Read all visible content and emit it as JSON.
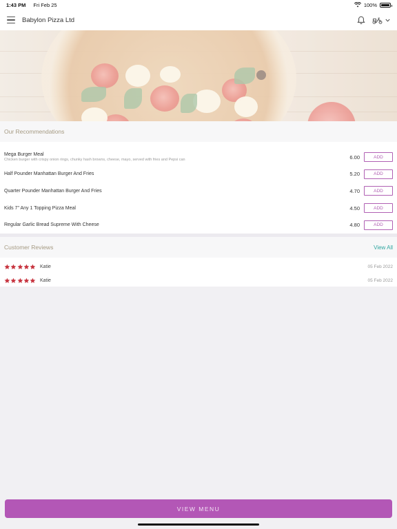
{
  "status_bar": {
    "time": "1:43 PM",
    "date": "Fri Feb 25",
    "battery": "100%"
  },
  "nav": {
    "title": "Babylon Pizza Ltd",
    "icons": [
      "menu-icon",
      "bell-icon",
      "scooter-icon",
      "chevron-down-icon"
    ]
  },
  "recommendations": {
    "title": "Our Recommendations",
    "add_label": "ADD",
    "items": [
      {
        "name": "Mega Burger Meal",
        "description": "Chicken burger with crispy onion rings, chunky hash browns, cheese, mayo, served with fries and Pepsi can",
        "price": "6.00"
      },
      {
        "name": "Half Pounder Manhattan Burger And Fries",
        "description": "",
        "price": "5.20"
      },
      {
        "name": "Quarter Pounder Manhattan Burger And Fries",
        "description": "",
        "price": "4.70"
      },
      {
        "name": "Kids 7\" Any 1 Topping Pizza Meal",
        "description": "",
        "price": "4.50"
      },
      {
        "name": "Regular Garlic Bread Supreme With Cheese",
        "description": "",
        "price": "4.80"
      }
    ]
  },
  "reviews": {
    "title": "Customer Reviews",
    "view_all": "View All",
    "items": [
      {
        "name": "Katie",
        "date": "05 Feb 2022",
        "rating": 5
      },
      {
        "name": "Katie",
        "date": "05 Feb 2022",
        "rating": 5
      }
    ]
  },
  "footer": {
    "view_menu_label": "VIEW MENU"
  },
  "colors": {
    "accent": "#b357b6",
    "link": "#2fa6a0",
    "star": "#c7343f"
  }
}
